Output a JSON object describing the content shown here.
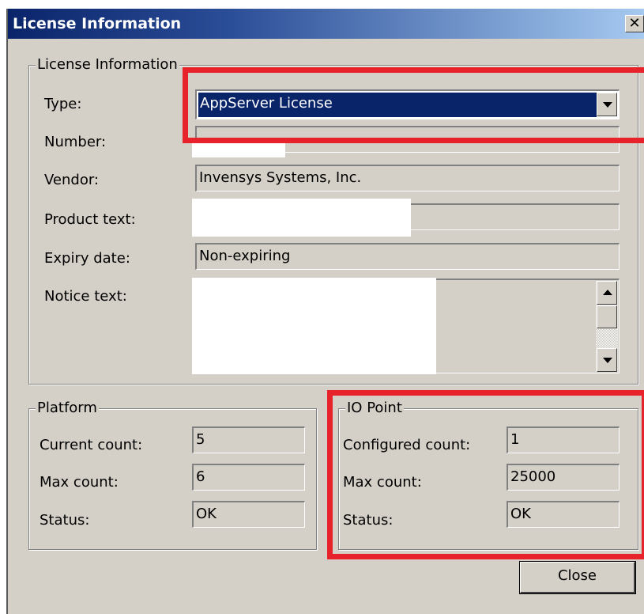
{
  "window": {
    "title": "License Information",
    "close_glyph": "✕"
  },
  "license": {
    "legend": "License Information",
    "type_label": "Type:",
    "type_value": "AppServer License",
    "number_label": "Number:",
    "number_value": "",
    "vendor_label": "Vendor:",
    "vendor_value": "Invensys Systems, Inc.",
    "product_label": "Product text:",
    "product_value": "",
    "expiry_label": "Expiry date:",
    "expiry_value": "Non-expiring",
    "notice_label": "Notice text:",
    "notice_value": ""
  },
  "platform": {
    "legend": "Platform",
    "current_label": "Current count:",
    "current_value": "5",
    "max_label": "Max count:",
    "max_value": "6",
    "status_label": "Status:",
    "status_value": "OK"
  },
  "io_point": {
    "legend": "IO Point",
    "configured_label": "Configured count:",
    "configured_value": "1",
    "max_label": "Max count:",
    "max_value": "25000",
    "status_label": "Status:",
    "status_value": "OK"
  },
  "buttons": {
    "close_label": "Close"
  },
  "annotations": {
    "highlight_color": "#e8222b"
  }
}
